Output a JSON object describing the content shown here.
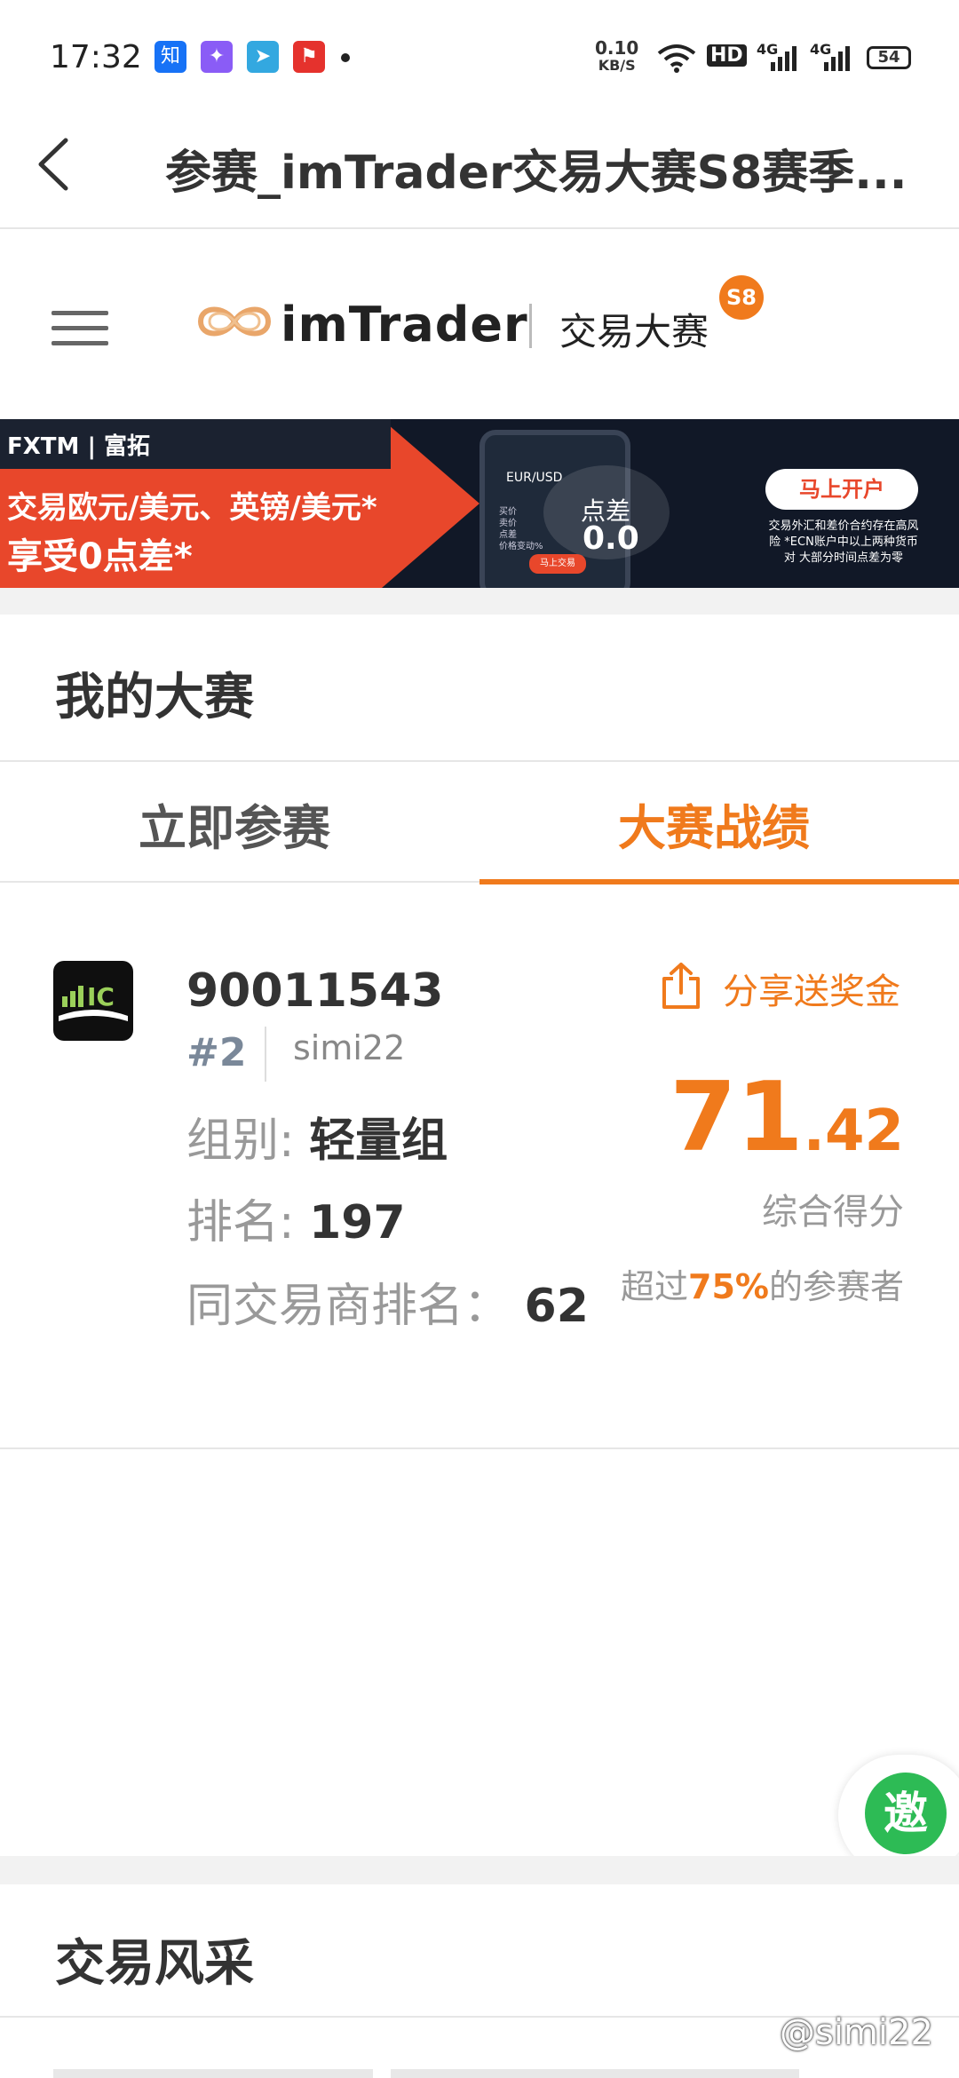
{
  "status_bar": {
    "time": "17:32",
    "apps": [
      {
        "icon": "zhihu-icon",
        "label": "知",
        "color": "#1772f6"
      },
      {
        "icon": "pin-app-icon",
        "label": "",
        "color": "#8a5cf6"
      },
      {
        "icon": "telegram-icon",
        "label": "",
        "color": "#33a8e0"
      },
      {
        "icon": "news-app-icon",
        "label": "",
        "color": "#e5322d"
      }
    ],
    "net_speed": "0.10",
    "net_unit": "KB/S",
    "hd_label": "HD",
    "signal1": "4G",
    "signal2": "4G",
    "battery": "54"
  },
  "nav": {
    "title": "参赛_imTrader交易大赛S8赛季..."
  },
  "brand": {
    "logo_text": "imTrader",
    "subtitle": "交易大赛",
    "season": "S8"
  },
  "banner": {
    "brand": "FXTM | 富拓",
    "line1": "交易欧元/美元、英镑/美元*",
    "line2": "享受0点差*",
    "phone_pair": "EUR/USD",
    "spread_label": "点差",
    "spread_value": "0.0",
    "phone_button": "马上交易",
    "cta": "马上开户",
    "disclaimer": "交易外汇和差价合约存在高风险 *ECN账户中以上两种货币对 大部分时间点差为零"
  },
  "my_contest": {
    "title": "我的大赛",
    "tabs": [
      {
        "label": "立即参赛",
        "active": false
      },
      {
        "label": "大赛战绩",
        "active": true
      }
    ]
  },
  "result": {
    "account": "90011543",
    "rank_tag": "#2",
    "username": "simi22",
    "group_label": "组别:",
    "group_value": "轻量组",
    "rank_label": "排名:",
    "rank_value": "197",
    "broker_rank_label": "同交易商排名：",
    "broker_rank_value": "62",
    "share_label": "分享送奖金",
    "score_int": "71",
    "score_dec": ".42",
    "score_label": "综合得分",
    "beat_prefix": "超过",
    "beat_pct": "75%",
    "beat_suffix": "的参赛者"
  },
  "invite_fab": {
    "label": "邀"
  },
  "trading_style": {
    "title": "交易风采"
  },
  "watermark": "@simi22",
  "colors": {
    "accent": "#f07a1c",
    "invite": "#2dbb55",
    "banner_red": "#e8472b"
  }
}
